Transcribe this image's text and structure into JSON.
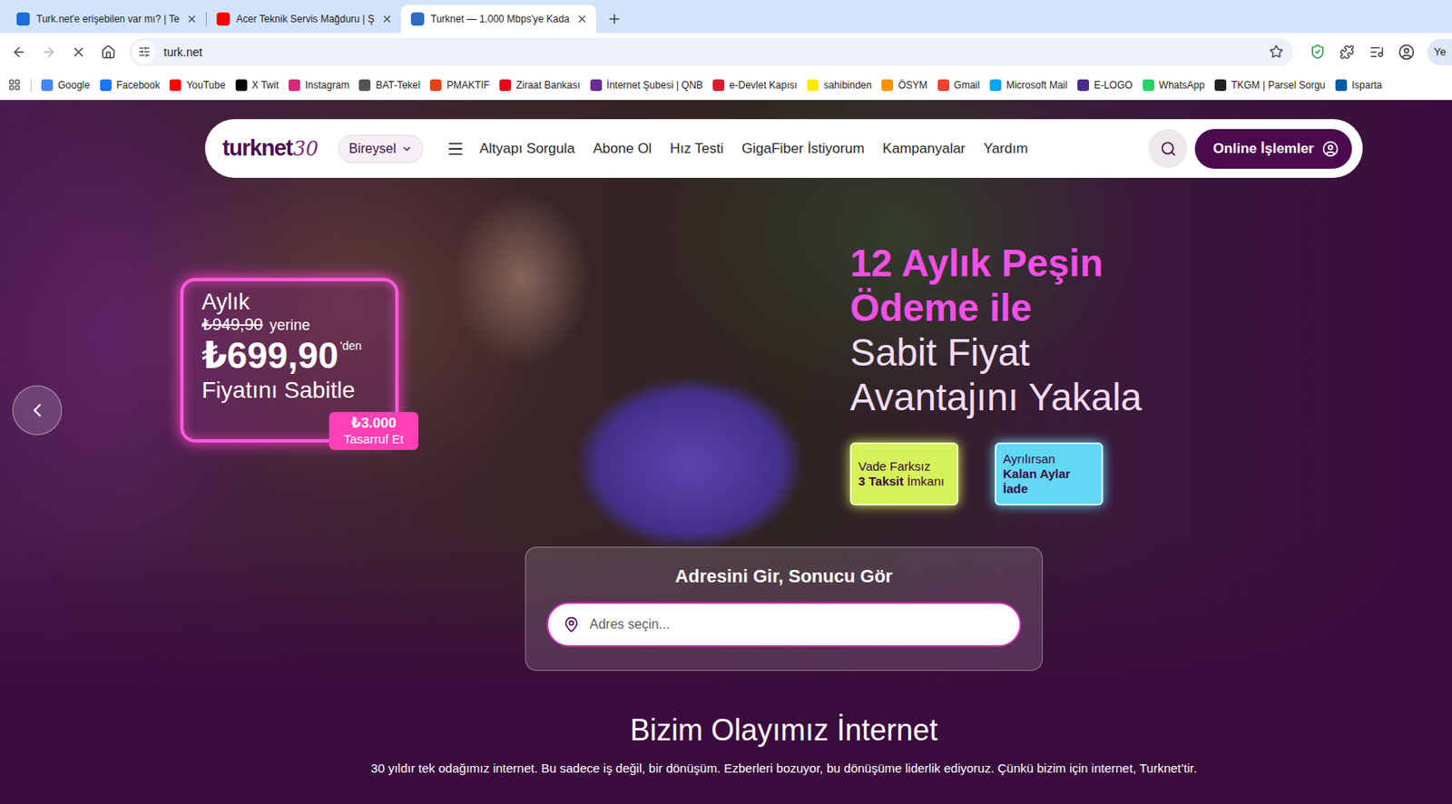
{
  "browser": {
    "tabs": [
      {
        "title": "Turk.net'e erişebilen var mı? | Te",
        "selected": false,
        "color": "#1a6ed8"
      },
      {
        "title": "Acer Teknik Servis Mağduru | Ş",
        "selected": false,
        "color": "#ff0000"
      },
      {
        "title": "Turknet — 1.000 Mbps'ye Kada",
        "selected": true,
        "color": "#2b6cc4"
      }
    ],
    "navigation": {
      "back_disabled": false,
      "forward_disabled": true,
      "loading": true
    },
    "address": {
      "url": "turk.net",
      "bookmarked": false
    },
    "profile_button": "Ye",
    "bookmarks": [
      {
        "label": "Google",
        "color": "#4285f4"
      },
      {
        "label": "Facebook",
        "color": "#1877f2"
      },
      {
        "label": "YouTube",
        "color": "#ff0000"
      },
      {
        "label": "X Twit",
        "color": "#000000"
      },
      {
        "label": "Instagram",
        "color": "#d62976"
      },
      {
        "label": "BAT-Tekel",
        "color": "#555555"
      },
      {
        "label": "PMAKTIF",
        "color": "#e0441a"
      },
      {
        "label": "Ziraat Bankası",
        "color": "#e30a17"
      },
      {
        "label": "İnternet Şubesi | QNB",
        "color": "#6a2c91"
      },
      {
        "label": "e-Devlet Kapısı",
        "color": "#d81e2c"
      },
      {
        "label": "sahibinden",
        "color": "#ffe800"
      },
      {
        "label": "ÖSYM",
        "color": "#f39200"
      },
      {
        "label": "Gmail",
        "color": "#ea4335"
      },
      {
        "label": "Microsoft Mail",
        "color": "#00a4ef"
      },
      {
        "label": "E-LOGO",
        "color": "#4b2c8a"
      },
      {
        "label": "WhatsApp",
        "color": "#25d366"
      },
      {
        "label": "TKGM | Parsel Sorgu",
        "color": "#222222"
      },
      {
        "label": "Isparta",
        "color": "#0a5aa8"
      }
    ]
  },
  "page": {
    "nav": {
      "logo": "turknet",
      "logo_badge": "30",
      "segment": "Bireysel",
      "links": [
        "Altyapı Sorgula",
        "Abone Ol",
        "Hız Testi",
        "GigaFiber İstiyorum",
        "Kampanyalar",
        "Yardım"
      ],
      "online_button": "Online İşlemler"
    },
    "promo_card": {
      "period": "Aylık",
      "old_price": "₺949,90",
      "old_price_suffix": "yerine",
      "price": "₺699,90",
      "price_suffix": "'den",
      "tagline": "Fiyatını Sabitle",
      "badge_amount": "₺3.000",
      "badge_label": "Tasarruf Et"
    },
    "headline": {
      "highlight": [
        "12 Aylık Peşin",
        "Ödeme ile"
      ],
      "rest": [
        "Sabit Fiyat",
        "Avantajını Yakala"
      ]
    },
    "features": [
      {
        "color": "#d6f25a",
        "lines": [
          [
            {
              "text": "Vade Farksız",
              "bold": false
            }
          ],
          [
            {
              "text": "3 Taksit",
              "bold": true
            },
            {
              "text": " İmkanı",
              "bold": false
            }
          ]
        ]
      },
      {
        "color": "#62d8f6",
        "lines": [
          [
            {
              "text": "Ayrılırsan",
              "bold": false
            }
          ],
          [
            {
              "text": "Kalan Aylar",
              "bold": true
            }
          ],
          [
            {
              "text": "İade",
              "bold": true
            }
          ]
        ]
      }
    ],
    "address_search": {
      "title": "Adresini Gir, Sonucu Gör",
      "placeholder": "Adres seçin..."
    },
    "about": {
      "title": "Bizim Olayımız İnternet",
      "text": "30 yıldır tek odağımız internet. Bu sadece iş değil, bir dönüşüm. Ezberleri bozuyor, bu dönüşüme liderlik ediyoruz. Çünkü bizim için internet, Turknet’tir."
    }
  }
}
